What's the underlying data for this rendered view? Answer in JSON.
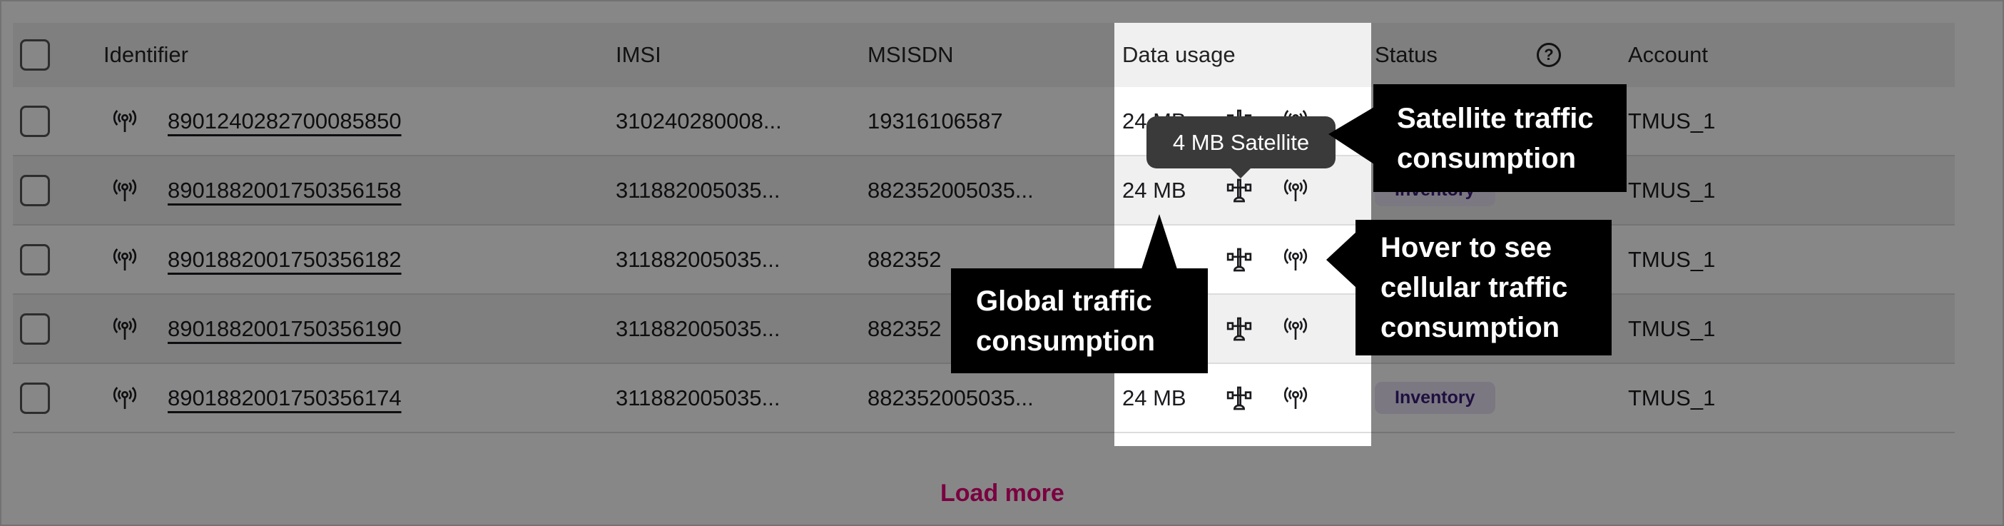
{
  "columns": {
    "identifier": "Identifier",
    "imsi": "IMSI",
    "msisdn": "MSISDN",
    "data_usage": "Data usage",
    "status": "Status",
    "account": "Account"
  },
  "status_help_icon": "question-circle-icon",
  "rows": [
    {
      "identifier": "8901240282700085850",
      "imsi": "310240280008...",
      "msisdn": "19316106587",
      "usage": "24 MB",
      "status": "",
      "account": "TMUS_1"
    },
    {
      "identifier": "8901882001750356158",
      "imsi": "311882005035...",
      "msisdn": "882352005035...",
      "usage": "24 MB",
      "status": "Inventory",
      "account": "TMUS_1"
    },
    {
      "identifier": "8901882001750356182",
      "imsi": "311882005035...",
      "msisdn": "882352",
      "usage": "",
      "status": "",
      "account": "TMUS_1"
    },
    {
      "identifier": "8901882001750356190",
      "imsi": "311882005035...",
      "msisdn": "882352",
      "usage": "",
      "status": "",
      "account": "TMUS_1"
    },
    {
      "identifier": "8901882001750356174",
      "imsi": "311882005035...",
      "msisdn": "882352005035...",
      "usage": "24 MB",
      "status": "Inventory",
      "account": "TMUS_1"
    }
  ],
  "tooltip": "4 MB Satellite",
  "load_more": "Load more",
  "callouts": {
    "satellite": "Satellite traffic consumption",
    "global": "Global traffic consumption",
    "hover": "Hover to see cellular traffic consumption"
  },
  "colors": {
    "accent": "#e20074",
    "badge_bg": "#e9e3f5",
    "badge_text": "#3a1d78",
    "overlay": "rgba(0,0,0,0.47)"
  }
}
